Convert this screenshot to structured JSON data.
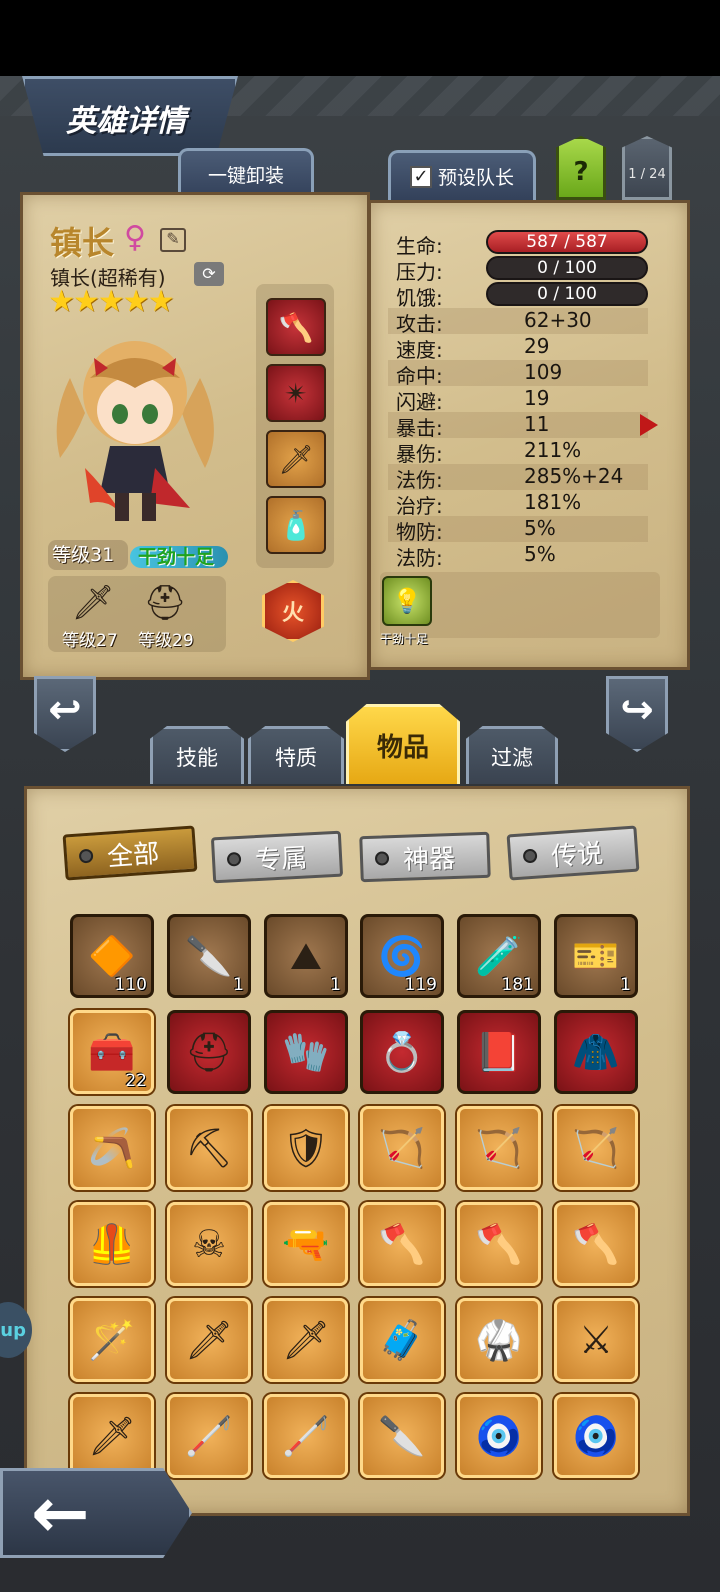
{
  "header": {
    "title": "英雄详情"
  },
  "top_buttons": {
    "unequip": "一键卸装",
    "preset_leader": "预设队长",
    "help": "?",
    "page": "1 / 24"
  },
  "hero": {
    "name": "镇长",
    "gender_icon": "♀",
    "subtitle": "镇长(超稀有)",
    "stars": "★★★★★",
    "level": "等级31",
    "mood": "干劲十足",
    "weapon_level": "等级27",
    "armor_level": "等级29",
    "element": "火"
  },
  "stats": {
    "hp": {
      "label": "生命:",
      "value": "587 / 587"
    },
    "stress": {
      "label": "压力:",
      "value": "0 / 100"
    },
    "hunger": {
      "label": "饥饿:",
      "value": "0 / 100"
    },
    "rows": [
      {
        "label": "攻击:",
        "value": "62+30"
      },
      {
        "label": "速度:",
        "value": "29"
      },
      {
        "label": "命中:",
        "value": "109"
      },
      {
        "label": "闪避:",
        "value": "19"
      },
      {
        "label": "暴击:",
        "value": "11"
      },
      {
        "label": "暴伤:",
        "value": "211%"
      },
      {
        "label": "法伤:",
        "value": "285%+24"
      },
      {
        "label": "治疗:",
        "value": "181%"
      },
      {
        "label": "物防:",
        "value": "5%"
      },
      {
        "label": "法防:",
        "value": "5%"
      }
    ],
    "trait": "干劲十足"
  },
  "tabs": [
    "技能",
    "特质",
    "物品",
    "过滤"
  ],
  "filters": [
    "全部",
    "专属",
    "神器",
    "传说"
  ],
  "items": [
    {
      "icon": "🔶",
      "count": "110"
    },
    {
      "icon": "🔪",
      "count": "1"
    },
    {
      "icon": "⛰",
      "count": "1"
    },
    {
      "icon": "🌀",
      "count": "119"
    },
    {
      "icon": "🧪",
      "count": "181"
    },
    {
      "icon": "🎫",
      "count": "1"
    },
    {
      "icon": "🧰",
      "count": "22"
    },
    {
      "icon": "⛑",
      "count": ""
    },
    {
      "icon": "🧤",
      "count": ""
    },
    {
      "icon": "💍",
      "count": ""
    },
    {
      "icon": "📕",
      "count": ""
    },
    {
      "icon": "🧥",
      "count": ""
    },
    {
      "icon": "🪃",
      "count": ""
    },
    {
      "icon": "⛏",
      "count": ""
    },
    {
      "icon": "🛡",
      "count": ""
    },
    {
      "icon": "🏹",
      "count": ""
    },
    {
      "icon": "🏹",
      "count": ""
    },
    {
      "icon": "🏹",
      "count": ""
    },
    {
      "icon": "🦺",
      "count": ""
    },
    {
      "icon": "☠",
      "count": ""
    },
    {
      "icon": "🔫",
      "count": ""
    },
    {
      "icon": "🪓",
      "count": ""
    },
    {
      "icon": "🪓",
      "count": ""
    },
    {
      "icon": "🪓",
      "count": ""
    },
    {
      "icon": "🪄",
      "count": ""
    },
    {
      "icon": "🗡",
      "count": ""
    },
    {
      "icon": "🗡",
      "count": ""
    },
    {
      "icon": "🧳",
      "count": ""
    },
    {
      "icon": "🥋",
      "count": ""
    },
    {
      "icon": "⚔",
      "count": ""
    },
    {
      "icon": "🗡",
      "count": ""
    },
    {
      "icon": "🦯",
      "count": ""
    },
    {
      "icon": "🦯",
      "count": ""
    },
    {
      "icon": "🔪",
      "count": ""
    },
    {
      "icon": "🧿",
      "count": ""
    },
    {
      "icon": "🧿",
      "count": ""
    }
  ],
  "side_bubble": "up",
  "colors": {
    "accent": "#e6a814",
    "hp_bar": "#c0282c",
    "parchment": "#d2bd8c"
  }
}
